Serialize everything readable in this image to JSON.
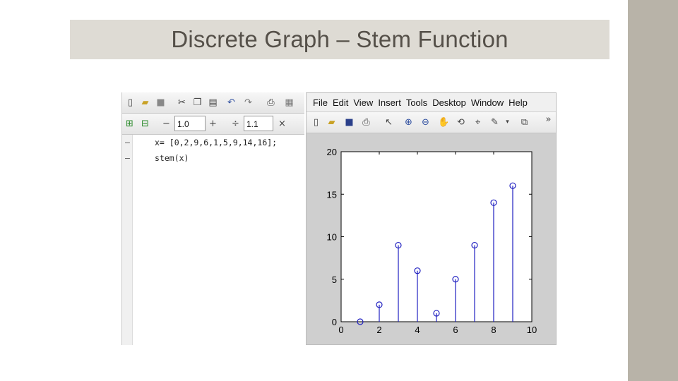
{
  "slide": {
    "title": "Discrete Graph – Stem Function"
  },
  "editor": {
    "zoom_field_1": "1.0",
    "zoom_field_2": "1.1",
    "minus_label": "−",
    "plus_label": "+",
    "divide_label": "÷",
    "times_label": "×",
    "code_lines": [
      "x= [0,2,9,6,1,5,9,14,16];",
      "stem(x)"
    ],
    "line_marker": "–"
  },
  "figure": {
    "menu": [
      "File",
      "Edit",
      "View",
      "Insert",
      "Tools",
      "Desktop",
      "Window",
      "Help"
    ],
    "toolbar_overflow": "»"
  },
  "chart_data": {
    "type": "stem",
    "x": [
      1,
      2,
      3,
      4,
      5,
      6,
      7,
      8,
      9
    ],
    "values": [
      0,
      2,
      9,
      6,
      1,
      5,
      9,
      14,
      16
    ],
    "xlim": [
      0,
      10
    ],
    "ylim": [
      0,
      20
    ],
    "xticks": [
      0,
      2,
      4,
      6,
      8,
      10
    ],
    "yticks": [
      0,
      5,
      10,
      15,
      20
    ],
    "color": "#2020c0",
    "grid": false
  }
}
